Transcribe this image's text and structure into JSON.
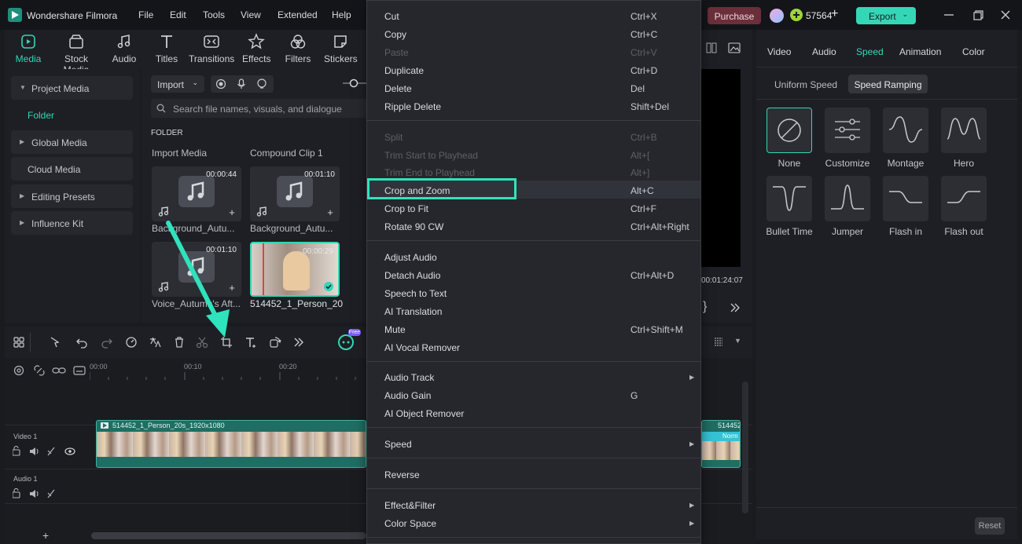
{
  "app": {
    "title": "Wondershare Filmora",
    "menu": [
      "File",
      "Edit",
      "Tools",
      "View",
      "Extended",
      "Help"
    ],
    "purchase": "Purchase",
    "credits": "57564",
    "export": "Export"
  },
  "toolbar": {
    "tabs": [
      {
        "label": "Media",
        "icon": "media-icon"
      },
      {
        "label": "Stock Media",
        "icon": "stock-media-icon"
      },
      {
        "label": "Audio",
        "icon": "music-icon"
      },
      {
        "label": "Titles",
        "icon": "titles-icon"
      },
      {
        "label": "Transitions",
        "icon": "transitions-icon"
      },
      {
        "label": "Effects",
        "icon": "effects-icon"
      },
      {
        "label": "Filters",
        "icon": "filters-icon"
      },
      {
        "label": "Stickers",
        "icon": "stickers-icon"
      }
    ]
  },
  "left_panel": {
    "project_media": "Project Media",
    "folder": "Folder",
    "global_media": "Global Media",
    "cloud_media": "Cloud Media",
    "editing_presets": "Editing Presets",
    "influence_kit": "Influence Kit"
  },
  "media": {
    "import": "Import",
    "search_placeholder": "Search file names, visuals, and dialogue",
    "folder_heading": "FOLDER",
    "import_media": "Import Media",
    "compound_clip": "Compound Clip 1",
    "items": [
      {
        "duration": "00:00:44",
        "name": "Background_Autu..."
      },
      {
        "duration": "00:01:10",
        "name": "Background_Autu..."
      },
      {
        "duration": "00:01:10",
        "name": "Voice_Autumn's Aft..."
      },
      {
        "duration": "00:00:29",
        "name": "514452_1_Person_20..."
      }
    ]
  },
  "context_menu": {
    "groups": [
      [
        {
          "label": "Cut",
          "shortcut": "Ctrl+X",
          "disabled": false
        },
        {
          "label": "Copy",
          "shortcut": "Ctrl+C",
          "disabled": false
        },
        {
          "label": "Paste",
          "shortcut": "Ctrl+V",
          "disabled": true
        },
        {
          "label": "Duplicate",
          "shortcut": "Ctrl+D",
          "disabled": false
        },
        {
          "label": "Delete",
          "shortcut": "Del",
          "disabled": false
        },
        {
          "label": "Ripple Delete",
          "shortcut": "Shift+Del",
          "disabled": false
        }
      ],
      [
        {
          "label": "Split",
          "shortcut": "Ctrl+B",
          "disabled": true
        },
        {
          "label": "Trim Start to Playhead",
          "shortcut": "Alt+[",
          "disabled": true
        },
        {
          "label": "Trim End to Playhead",
          "shortcut": "Alt+]",
          "disabled": true
        },
        {
          "label": "Crop and Zoom",
          "shortcut": "Alt+C",
          "disabled": false,
          "highlighted": true
        },
        {
          "label": "Crop to Fit",
          "shortcut": "Ctrl+F",
          "disabled": false
        },
        {
          "label": "Rotate 90 CW",
          "shortcut": "Ctrl+Alt+Right",
          "disabled": false
        }
      ],
      [
        {
          "label": "Adjust Audio",
          "shortcut": "",
          "disabled": false
        },
        {
          "label": "Detach Audio",
          "shortcut": "Ctrl+Alt+D",
          "disabled": false
        },
        {
          "label": "Speech to Text",
          "shortcut": "",
          "disabled": false
        },
        {
          "label": "AI Translation",
          "shortcut": "",
          "disabled": false
        },
        {
          "label": "Mute",
          "shortcut": "Ctrl+Shift+M",
          "disabled": false
        },
        {
          "label": "AI Vocal Remover",
          "shortcut": "",
          "disabled": false
        }
      ],
      [
        {
          "label": "Audio Track",
          "shortcut": "",
          "disabled": false,
          "submenu": true
        },
        {
          "label": "Audio Gain",
          "shortcut": "G",
          "disabled": false
        },
        {
          "label": "AI Object Remover",
          "shortcut": "",
          "disabled": false
        }
      ],
      [
        {
          "label": "Speed",
          "shortcut": "",
          "disabled": false,
          "submenu": true
        }
      ],
      [
        {
          "label": "Reverse",
          "shortcut": "",
          "disabled": false
        }
      ],
      [
        {
          "label": "Effect&Filter",
          "shortcut": "",
          "disabled": false,
          "submenu": true
        },
        {
          "label": "Color Space",
          "shortcut": "",
          "disabled": false,
          "submenu": true
        }
      ]
    ]
  },
  "timeline": {
    "ticks": [
      "00:00",
      "00:10",
      "00:20"
    ],
    "video_track": "Video 1",
    "audio_track": "Audio 1",
    "clip_name": "514452_1_Person_20s_1920x1080",
    "clip_name_right": "514452_1...",
    "clip_badge": "Norm",
    "free_badge": "Free"
  },
  "preview": {
    "timecode": "00:01:24:07"
  },
  "right_panel": {
    "tabs": [
      "Video",
      "Audio",
      "Speed",
      "Animation",
      "Color"
    ],
    "active_tab": "Speed",
    "subtabs": [
      "Uniform Speed",
      "Speed Ramping"
    ],
    "active_subtab": "Speed Ramping",
    "presets": [
      "None",
      "Customize",
      "Montage",
      "Hero",
      "Bullet Time",
      "Jumper",
      "Flash in",
      "Flash out"
    ],
    "reset": "Reset"
  },
  "colors": {
    "accent": "#35d6b6",
    "highlight_box": "#2fe3bd",
    "clip": "#1f6e63"
  }
}
